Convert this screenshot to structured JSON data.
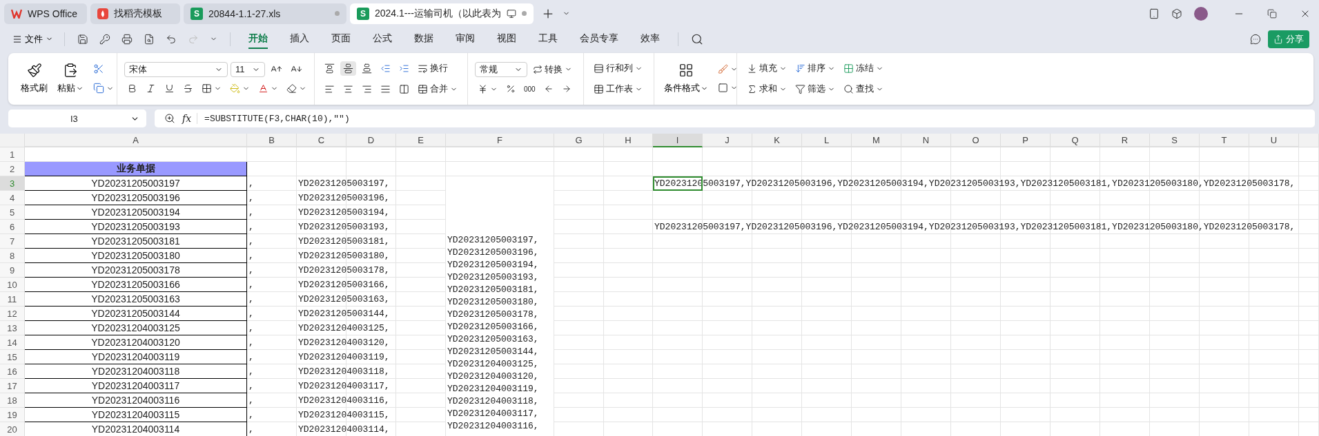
{
  "tabs": [
    {
      "kind": "home",
      "label": "WPS Office",
      "selected": false
    },
    {
      "kind": "template",
      "label": "找稻壳模板",
      "selected": false
    },
    {
      "kind": "sheet",
      "badge": "S",
      "label": "20844-1.1-27.xls",
      "selected": false
    },
    {
      "kind": "sheet",
      "badge": "S",
      "label": "2024.1---运输司机（以此表为",
      "selected": true
    }
  ],
  "menu": {
    "file": "文件",
    "items": [
      {
        "label": "开始",
        "selected": true
      },
      {
        "label": "插入",
        "selected": false
      },
      {
        "label": "页面",
        "selected": false
      },
      {
        "label": "公式",
        "selected": false
      },
      {
        "label": "数据",
        "selected": false
      },
      {
        "label": "审阅",
        "selected": false
      },
      {
        "label": "视图",
        "selected": false
      },
      {
        "label": "工具",
        "selected": false
      },
      {
        "label": "会员专享",
        "selected": false
      },
      {
        "label": "效率",
        "selected": false
      }
    ],
    "share": "分享"
  },
  "ribbon": {
    "format_painter": "格式刷",
    "paste": "粘贴",
    "font_name": "宋体",
    "font_size": "11",
    "vertical_align": [
      {
        "kind": "top",
        "selected": false
      },
      {
        "kind": "middle",
        "selected": true
      },
      {
        "kind": "bottom",
        "selected": false
      }
    ],
    "wrap": "换行",
    "merge": "合并",
    "number_format": "常规",
    "convert": "转换",
    "thousands": "000",
    "rows_cols": "行和列",
    "worksheet": "工作表",
    "conditional_format": "条件格式",
    "fill": "填充",
    "sort": "排序",
    "freeze": "冻结",
    "sum": "求和",
    "filter": "筛选",
    "find": "查找"
  },
  "formula_bar": {
    "cell_ref": "I3",
    "fx": "fx",
    "formula": "=SUBSTITUTE(F3,CHAR(10),\"\")"
  },
  "sheet": {
    "columns": [
      {
        "label": "A",
        "selected": false
      },
      {
        "label": "B",
        "selected": false
      },
      {
        "label": "C",
        "selected": false
      },
      {
        "label": "D",
        "selected": false
      },
      {
        "label": "E",
        "selected": false
      },
      {
        "label": "F",
        "selected": false
      },
      {
        "label": "G",
        "selected": false
      },
      {
        "label": "H",
        "selected": false
      },
      {
        "label": "I",
        "selected": true
      },
      {
        "label": "J",
        "selected": false
      },
      {
        "label": "K",
        "selected": false
      },
      {
        "label": "L",
        "selected": false
      },
      {
        "label": "M",
        "selected": false
      },
      {
        "label": "N",
        "selected": false
      },
      {
        "label": "O",
        "selected": false
      },
      {
        "label": "P",
        "selected": false
      },
      {
        "label": "Q",
        "selected": false
      },
      {
        "label": "R",
        "selected": false
      },
      {
        "label": "S",
        "selected": false
      },
      {
        "label": "T",
        "selected": false
      },
      {
        "label": "U",
        "selected": false
      }
    ],
    "rows": [
      {
        "number": "1",
        "kind": "blank",
        "selected": false
      },
      {
        "number": "2",
        "kind": "header",
        "selected": false,
        "a": "业务单据"
      },
      {
        "number": "3",
        "kind": "data",
        "selected": true,
        "a": "YD20231205003197",
        "b": ",",
        "c": "YD20231205003197,",
        "i": "YD20231205003197,YD20231205003196,YD20231205003194,YD20231205003193,YD20231205003181,YD20231205003180,YD20231205003178,"
      },
      {
        "number": "4",
        "kind": "data",
        "selected": false,
        "a": "YD20231205003196",
        "b": ",",
        "c": "YD20231205003196,"
      },
      {
        "number": "5",
        "kind": "data",
        "selected": false,
        "a": "YD20231205003194",
        "b": ",",
        "c": "YD20231205003194,"
      },
      {
        "number": "6",
        "kind": "data",
        "selected": false,
        "a": "YD20231205003193",
        "b": ",",
        "c": "YD20231205003193,",
        "i": "YD20231205003197,YD20231205003196,YD20231205003194,YD20231205003193,YD20231205003181,YD20231205003180,YD20231205003178,"
      },
      {
        "number": "7",
        "kind": "data",
        "selected": false,
        "a": "YD20231205003181",
        "b": ",",
        "c": "YD20231205003181,"
      },
      {
        "number": "8",
        "kind": "data",
        "selected": false,
        "a": "YD20231205003180",
        "b": ",",
        "c": "YD20231205003180,"
      },
      {
        "number": "9",
        "kind": "data",
        "selected": false,
        "a": "YD20231205003178",
        "b": ",",
        "c": "YD20231205003178,"
      },
      {
        "number": "10",
        "kind": "data",
        "selected": false,
        "a": "YD20231205003166",
        "b": ",",
        "c": "YD20231205003166,"
      },
      {
        "number": "11",
        "kind": "data",
        "selected": false,
        "a": "YD20231205003163",
        "b": ",",
        "c": "YD20231205003163,"
      },
      {
        "number": "12",
        "kind": "data",
        "selected": false,
        "a": "YD20231205003144",
        "b": ",",
        "c": "YD20231205003144,"
      },
      {
        "number": "13",
        "kind": "data",
        "selected": false,
        "a": "YD20231204003125",
        "b": ",",
        "c": "YD20231204003125,"
      },
      {
        "number": "14",
        "kind": "data",
        "selected": false,
        "a": "YD20231204003120",
        "b": ",",
        "c": "YD20231204003120,"
      },
      {
        "number": "15",
        "kind": "data",
        "selected": false,
        "a": "YD20231204003119",
        "b": ",",
        "c": "YD20231204003119,"
      },
      {
        "number": "16",
        "kind": "data",
        "selected": false,
        "a": "YD20231204003118",
        "b": ",",
        "c": "YD20231204003118,"
      },
      {
        "number": "17",
        "kind": "data",
        "selected": false,
        "a": "YD20231204003117",
        "b": ",",
        "c": "YD20231204003117,"
      },
      {
        "number": "18",
        "kind": "data",
        "selected": false,
        "a": "YD20231204003116",
        "b": ",",
        "c": "YD20231204003116,"
      },
      {
        "number": "19",
        "kind": "data",
        "selected": false,
        "a": "YD20231204003115",
        "b": ",",
        "c": "YD20231204003115,"
      },
      {
        "number": "20",
        "kind": "data",
        "selected": false,
        "a": "YD20231204003114",
        "b": ",",
        "c": "YD20231204003114,"
      }
    ],
    "wrapped_cell": {
      "lines": [
        "YD20231205003197,",
        "YD20231205003196,",
        "YD20231205003194,",
        "YD20231205003193,",
        "YD20231205003181,",
        "YD20231205003180,",
        "YD20231205003178,",
        "YD20231205003166,",
        "YD20231205003163,",
        "YD20231205003144,",
        "YD20231204003125,",
        "YD20231204003120,",
        "YD20231204003119,",
        "YD20231204003118,",
        "YD20231204003117,",
        "YD20231204003116,"
      ]
    }
  }
}
